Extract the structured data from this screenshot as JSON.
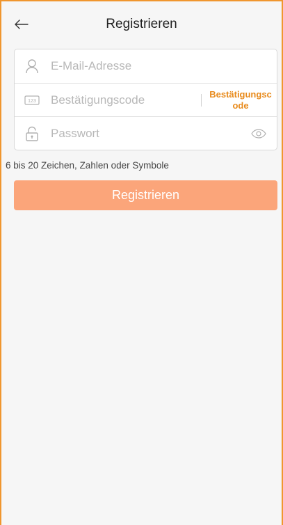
{
  "header": {
    "title": "Registrieren",
    "back_icon": "arrow-left-icon"
  },
  "form": {
    "email": {
      "placeholder": "E-Mail-Adresse",
      "icon": "user-icon"
    },
    "code": {
      "placeholder": "Bestätigungscode",
      "icon": "code-123-icon",
      "button_label": "Bestätigungscode"
    },
    "password": {
      "placeholder": "Passwort",
      "icon": "lock-icon",
      "toggle_icon": "eye-icon"
    }
  },
  "hint": "6 bis 20 Zeichen, Zahlen oder Symbole",
  "submit_label": "Registrieren",
  "colors": {
    "accent": "#e88a1b",
    "button": "#fba57a",
    "frame": "#f0962e"
  }
}
